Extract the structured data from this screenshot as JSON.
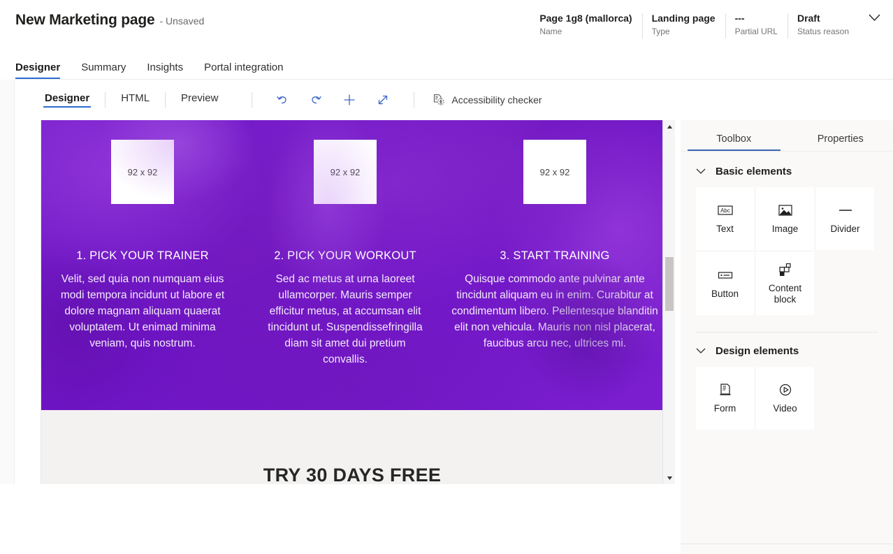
{
  "header": {
    "title": "New Marketing page",
    "subtitle": "- Unsaved",
    "meta": [
      {
        "value": "Page 1g8 (mallorca)",
        "label": "Name"
      },
      {
        "value": "Landing page",
        "label": "Type"
      },
      {
        "value": "---",
        "label": "Partial URL"
      },
      {
        "value": "Draft",
        "label": "Status reason"
      }
    ],
    "chevron_icon": "chevron-down-icon"
  },
  "nav_tabs": [
    {
      "label": "Designer",
      "active": true
    },
    {
      "label": "Summary",
      "active": false
    },
    {
      "label": "Insights",
      "active": false
    },
    {
      "label": "Portal integration",
      "active": false
    }
  ],
  "designer_toolbar": {
    "sub_tabs": [
      {
        "label": "Designer",
        "active": true
      },
      {
        "label": "HTML",
        "active": false
      },
      {
        "label": "Preview",
        "active": false
      }
    ],
    "tools": [
      {
        "name": "undo-icon",
        "title": "Undo"
      },
      {
        "name": "redo-icon",
        "title": "Redo"
      },
      {
        "name": "add-icon",
        "title": "Add"
      },
      {
        "name": "expand-icon",
        "title": "Expand"
      }
    ],
    "accessibility_checker": "Accessibility checker",
    "accessibility_icon": "accessibility-checker-icon"
  },
  "canvas": {
    "columns": [
      {
        "image_placeholder": "92 x 92",
        "heading": "1. PICK YOUR TRAINER",
        "body": "Velit, sed quia non numquam eius modi tempora incidunt ut labore et dolore magnam aliquam quaerat voluptatem. Ut enimad minima veniam, quis nostrum."
      },
      {
        "image_placeholder": "92 x 92",
        "heading": "2. PICK YOUR WORKOUT",
        "body": "Sed ac metus at urna laoreet ullamcorper. Mauris semper efficitur metus, at accumsan elit tincidunt ut. Suspendissefringilla diam sit amet dui pretium convallis."
      },
      {
        "image_placeholder": "92 x 92",
        "heading": "3. START TRAINING",
        "body": "Quisque commodo ante pulvinar ante tincidunt aliquam eu in enim. Curabitur at condimentum libero. Pellentesque blanditin elit non vehicula. Mauris non nisl placerat, faucibus arcu nec, ultrices mi."
      }
    ],
    "cta_heading": "TRY 30 DAYS FREE",
    "scrollbar": {
      "up_icon": "scroll-up-arrow-icon",
      "down_icon": "scroll-down-arrow-icon"
    }
  },
  "right_panel": {
    "tabs": [
      {
        "label": "Toolbox",
        "active": true
      },
      {
        "label": "Properties",
        "active": false
      }
    ],
    "sections": [
      {
        "title": "Basic elements",
        "collapse_icon": "chevron-down-icon",
        "tiles": [
          {
            "label": "Text",
            "icon": "text-abc-icon"
          },
          {
            "label": "Image",
            "icon": "image-icon"
          },
          {
            "label": "Divider",
            "icon": "divider-icon"
          },
          {
            "label": "Button",
            "icon": "button-icon"
          },
          {
            "label": "Content block",
            "icon": "content-block-icon"
          }
        ]
      },
      {
        "title": "Design elements",
        "collapse_icon": "chevron-down-icon",
        "tiles": [
          {
            "label": "Form",
            "icon": "form-icon"
          },
          {
            "label": "Video",
            "icon": "video-icon"
          }
        ]
      }
    ]
  },
  "colors": {
    "accent_blue": "#2b6cd0",
    "tool_blue": "#3c63c8",
    "hero_purple": "#6d14c2",
    "hero_purple_light": "#7a21cf",
    "panel_bg": "#faf9f8",
    "canvas_bg": "#f3f2f1"
  }
}
